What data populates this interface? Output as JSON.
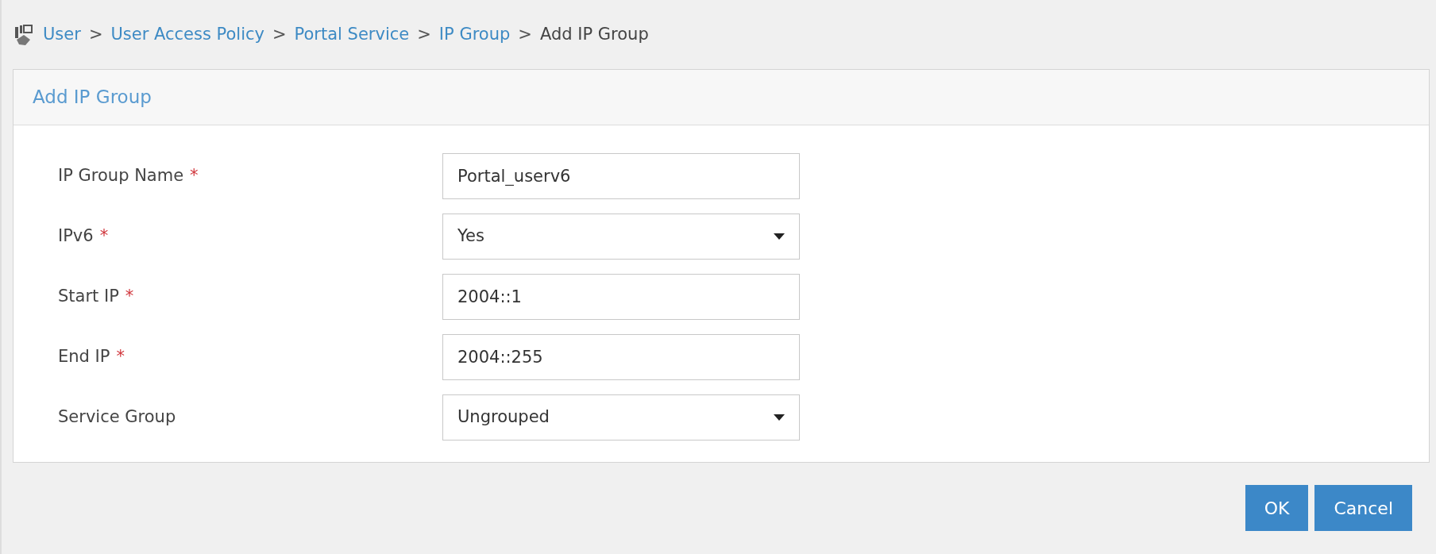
{
  "breadcrumb": [
    {
      "label": "User",
      "current": false
    },
    {
      "label": "User Access Policy",
      "current": false
    },
    {
      "label": "Portal Service",
      "current": false
    },
    {
      "label": "IP Group",
      "current": false
    },
    {
      "label": "Add IP Group",
      "current": true
    }
  ],
  "separator": ">",
  "panel": {
    "title": "Add IP Group"
  },
  "fields": [
    {
      "kind": "input",
      "label": "IP Group Name",
      "required": true,
      "value": "Portal_userv6"
    },
    {
      "kind": "select",
      "label": "IPv6",
      "required": true,
      "value": "Yes"
    },
    {
      "kind": "input",
      "label": "Start IP",
      "required": true,
      "value": "2004::1"
    },
    {
      "kind": "input",
      "label": "End IP",
      "required": true,
      "value": "2004::255"
    },
    {
      "kind": "select",
      "label": "Service Group",
      "required": false,
      "value": "Ungrouped"
    }
  ],
  "required_mark": "*",
  "buttons": [
    "OK",
    "Cancel"
  ]
}
